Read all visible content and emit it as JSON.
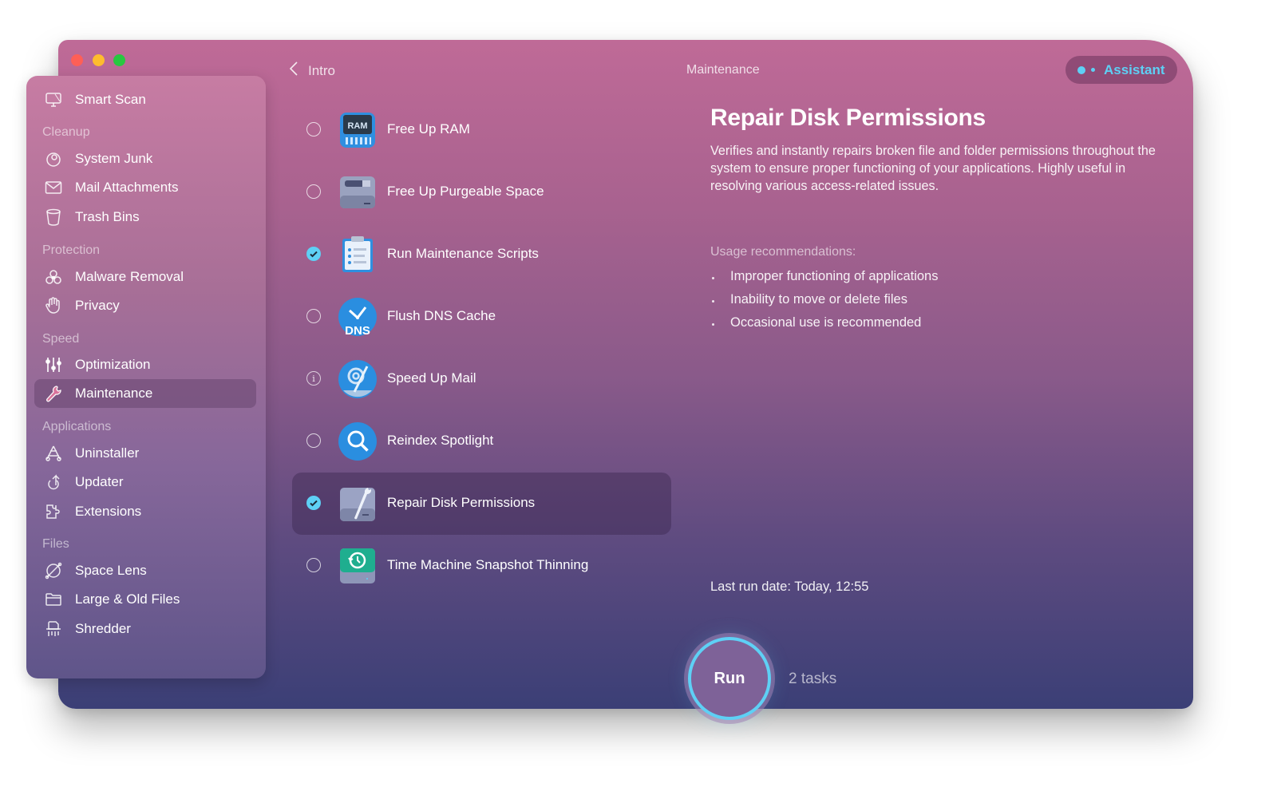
{
  "window": {
    "title": "Maintenance",
    "traffic_lights": [
      "close",
      "minimize",
      "zoom"
    ]
  },
  "sidebar": {
    "top_item": {
      "label": "Smart Scan",
      "icon": "monitor-icon"
    },
    "sections": [
      {
        "title": "Cleanup",
        "items": [
          {
            "label": "System Junk",
            "icon": "system-junk-icon"
          },
          {
            "label": "Mail Attachments",
            "icon": "envelope-icon"
          },
          {
            "label": "Trash Bins",
            "icon": "trash-icon"
          }
        ]
      },
      {
        "title": "Protection",
        "items": [
          {
            "label": "Malware Removal",
            "icon": "biohazard-icon"
          },
          {
            "label": "Privacy",
            "icon": "hand-icon"
          }
        ]
      },
      {
        "title": "Speed",
        "items": [
          {
            "label": "Optimization",
            "icon": "sliders-icon"
          },
          {
            "label": "Maintenance",
            "icon": "wrench-icon",
            "active": true
          }
        ]
      },
      {
        "title": "Applications",
        "items": [
          {
            "label": "Uninstaller",
            "icon": "uninstaller-icon"
          },
          {
            "label": "Updater",
            "icon": "update-arrow-icon"
          },
          {
            "label": "Extensions",
            "icon": "puzzle-icon"
          }
        ]
      },
      {
        "title": "Files",
        "items": [
          {
            "label": "Space Lens",
            "icon": "planet-icon"
          },
          {
            "label": "Large & Old Files",
            "icon": "folder-icon"
          },
          {
            "label": "Shredder",
            "icon": "shredder-icon"
          }
        ]
      }
    ]
  },
  "header": {
    "back_label": "Intro",
    "title": "Maintenance",
    "assistant_label": "Assistant"
  },
  "tasks": [
    {
      "label": "Free Up RAM",
      "state": "unchecked",
      "icon": "ram-chip-icon",
      "icon_text": "RAM"
    },
    {
      "label": "Free Up Purgeable Space",
      "state": "unchecked",
      "icon": "drive-icon"
    },
    {
      "label": "Run Maintenance Scripts",
      "state": "checked",
      "icon": "clipboard-icon"
    },
    {
      "label": "Flush DNS Cache",
      "state": "unchecked",
      "icon": "dns-icon",
      "icon_text": "DNS"
    },
    {
      "label": "Speed Up Mail",
      "state": "info",
      "icon": "mail-speed-icon"
    },
    {
      "label": "Reindex Spotlight",
      "state": "unchecked",
      "icon": "spotlight-icon"
    },
    {
      "label": "Repair Disk Permissions",
      "state": "checked",
      "icon": "disk-wrench-icon",
      "selected": true
    },
    {
      "label": "Time Machine Snapshot Thinning",
      "state": "unchecked",
      "icon": "time-machine-icon"
    }
  ],
  "detail": {
    "title": "Repair Disk Permissions",
    "description": "Verifies and instantly repairs broken file and folder permissions throughout the system to ensure proper functioning of your applications. Highly useful in resolving various access-related issues.",
    "usage_heading": "Usage recommendations:",
    "usage_items": [
      "Improper functioning of applications",
      "Inability to move or delete files",
      "Occasional use is recommended"
    ],
    "last_run_label": "Last run date:",
    "last_run_value": "Today, 12:55"
  },
  "footer": {
    "run_label": "Run",
    "tasks_count": "2 tasks"
  },
  "colors": {
    "accent": "#5ed0f5",
    "close": "#fe5f57",
    "minimize": "#febc2e",
    "zoom": "#28c840"
  }
}
